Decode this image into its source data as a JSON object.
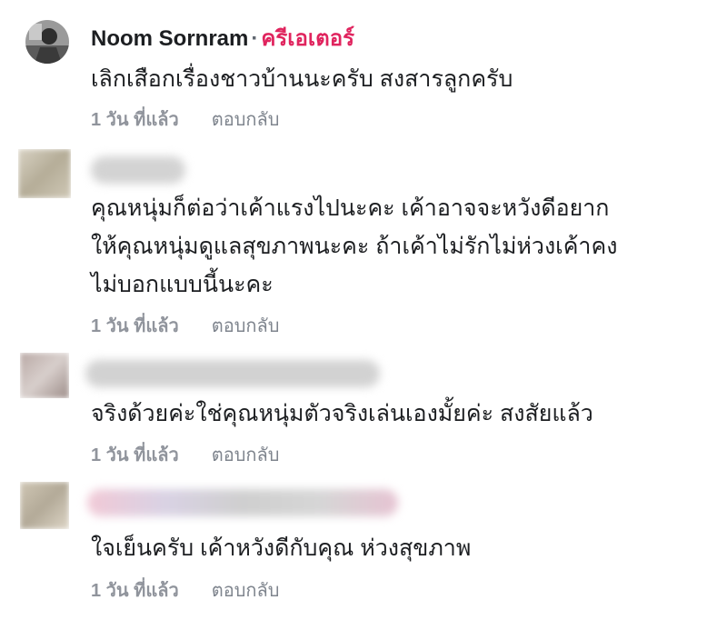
{
  "comments": [
    {
      "author": "Noom Sornram",
      "separator": "·",
      "badge": "ครีเอเตอร์",
      "lines": [
        "เลิกเสือกเรื่องชาวบ้านนะครับ สงสารลูกครับ"
      ],
      "time": "1 วัน ที่แล้ว",
      "reply": "ตอบกลับ"
    },
    {
      "lines": [
        "คุณหนุ่มก็ต่อว่าเค้าแรงไปนะคะ เค้าอาจจะหวังดีอยาก",
        "ให้คุณหนุ่มดูแลสุขภาพนะคะ ถ้าเค้าไม่รักไม่ห่วงเค้าคง",
        "ไม่บอกแบบนี้นะคะ"
      ],
      "time": "1 วัน ที่แล้ว",
      "reply": "ตอบกลับ"
    },
    {
      "lines": [
        "จริงด้วยค่ะใช่คุณหนุ่มตัวจริงเล่นเองมั้ยค่ะ สงสัยแล้ว"
      ],
      "time": "1 วัน ที่แล้ว",
      "reply": "ตอบกลับ"
    },
    {
      "lines": [
        "ใจเย็นครับ เค้าหวังดีกับคุณ ห่วงสุขภาพ"
      ],
      "time": "1 วัน ที่แล้ว",
      "reply": "ตอบกลับ"
    }
  ],
  "colors": {
    "badge": "#e0245e",
    "meta": "#8d949e",
    "text": "#1c1e21"
  }
}
